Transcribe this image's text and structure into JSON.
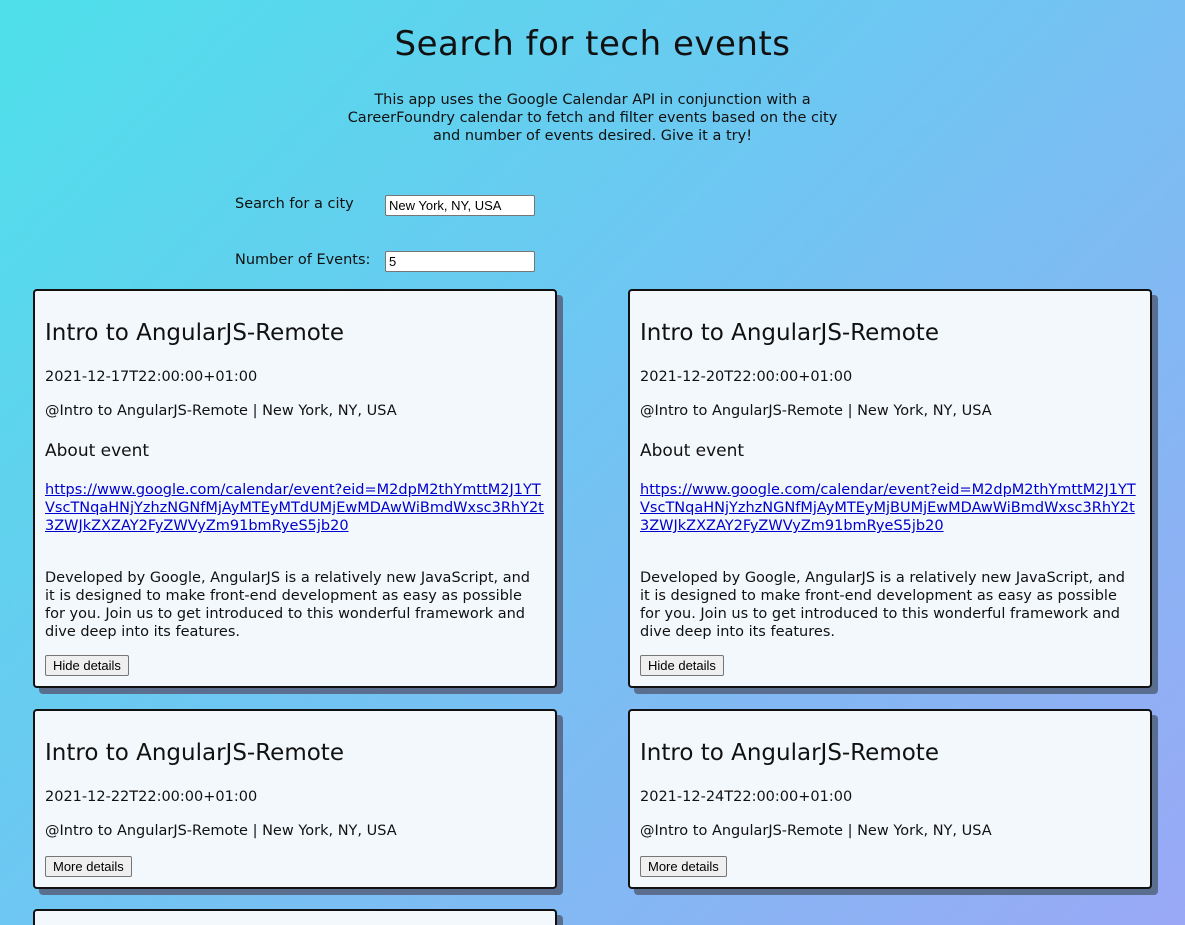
{
  "header": {
    "title": "Search for tech events",
    "intro": "This app uses the Google Calendar API in conjunction with a CareerFoundry calendar to fetch and filter events based on the city and number of events desired. Give it a try!"
  },
  "search": {
    "city_label": "Search for a city",
    "city_value": "New York, NY, USA",
    "number_label": "Number of Events:",
    "number_value": "5"
  },
  "events": [
    {
      "title": "Intro to AngularJS-Remote",
      "date": "2021-12-17T22:00:00+01:00",
      "location": "@Intro to AngularJS-Remote | New York, NY, USA",
      "about_label": "About event",
      "link": "https://www.google.com/calendar/event?eid=M2dpM2thYmttM2J1YTVscTNqaHNjYzhzNGNfMjAyMTEyMTdUMjEwMDAwWiBmdWxsc3RhY2t3ZWJkZXZAY2FyZWVyZm91bmRyeS5jb20",
      "description": "Developed by Google, AngularJS is a relatively new JavaScript, and it is designed to make front-end development as easy as possible for you. Join us to get introduced to this wonderful framework and dive deep into its features.",
      "button": "Hide details"
    },
    {
      "title": "Intro to AngularJS-Remote",
      "date": "2021-12-20T22:00:00+01:00",
      "location": "@Intro to AngularJS-Remote | New York, NY, USA",
      "about_label": "About event",
      "link": "https://www.google.com/calendar/event?eid=M2dpM2thYmttM2J1YTVscTNqaHNjYzhzNGNfMjAyMTEyMjBUMjEwMDAwWiBmdWxsc3RhY2t3ZWJkZXZAY2FyZWVyZm91bmRyeS5jb20",
      "description": "Developed by Google, AngularJS is a relatively new JavaScript, and it is designed to make front-end development as easy as possible for you. Join us to get introduced to this wonderful framework and dive deep into its features.",
      "button": "Hide details"
    },
    {
      "title": "Intro to AngularJS-Remote",
      "date": "2021-12-22T22:00:00+01:00",
      "location": "@Intro to AngularJS-Remote | New York, NY, USA",
      "button": "More details"
    },
    {
      "title": "Intro to AngularJS-Remote",
      "date": "2021-12-24T22:00:00+01:00",
      "location": "@Intro to AngularJS-Remote | New York, NY, USA",
      "button": "More details"
    }
  ]
}
